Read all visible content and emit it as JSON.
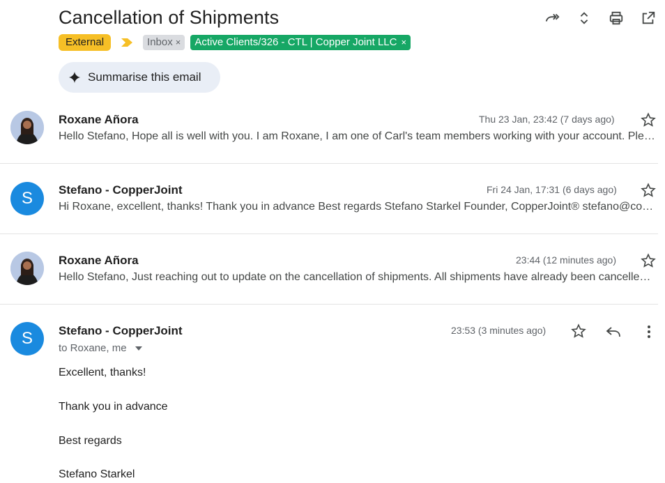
{
  "subject": "Cancellation of Shipments",
  "labels": {
    "external": "External",
    "inbox": "Inbox",
    "client": "Active Clients/326 - CTL | Copper Joint LLC",
    "remove_symbol": "×"
  },
  "summarise_label": "Summarise this email",
  "top_icons": [
    "forward-all-icon",
    "expand-collapse-icon",
    "print-icon",
    "open-in-new-window-icon"
  ],
  "messages": [
    {
      "sender": "Roxane Añora",
      "date": "Thu 23 Jan, 23:42 (7 days ago)",
      "snippet": "Hello Stefano, Hope all is well with you. I am Roxane, I am one of Carl's team members working with your account. Please",
      "avatar": "photo"
    },
    {
      "sender": "Stefano - CopperJoint",
      "date": "Fri 24 Jan, 17:31 (6 days ago)",
      "snippet": "Hi Roxane, excellent, thanks! Thank you in advance Best regards Stefano Starkel Founder, CopperJoint® stefano@copperjoint.com",
      "avatar": "S"
    },
    {
      "sender": "Roxane Añora",
      "date": "23:44 (12 minutes ago)",
      "snippet": "Hello Stefano, Just reaching out to update on the cancellation of shipments. All shipments have already been cancelled in",
      "avatar": "photo"
    }
  ],
  "open_message": {
    "sender": "Stefano - CopperJoint",
    "avatar": "S",
    "date": "23:53 (3 minutes ago)",
    "to": "to Roxane, me",
    "body": [
      "Excellent, thanks!",
      "Thank you in advance",
      "Best regards",
      "Stefano Starkel"
    ]
  },
  "colors": {
    "external_tag": "#f6bf26",
    "client_tag": "#16a765",
    "avatar_blue": "#1a8adf",
    "summarise_bg": "#e9eef6"
  }
}
